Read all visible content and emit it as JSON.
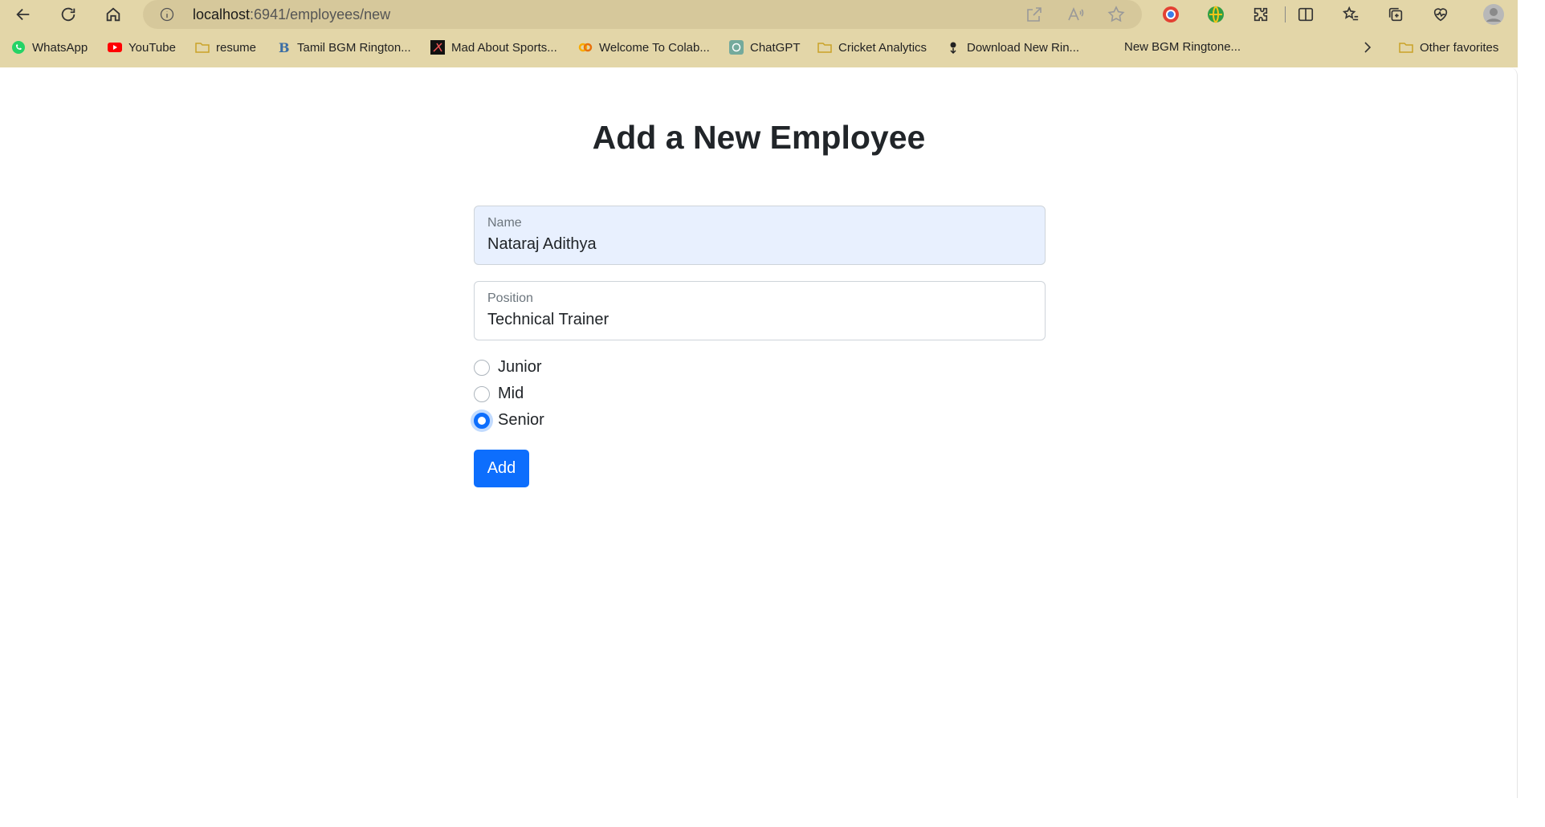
{
  "browser": {
    "url_host": "localhost",
    "url_rest": ":6941/employees/new",
    "bookmarks": [
      {
        "label": "WhatsApp",
        "icon": "whatsapp-icon"
      },
      {
        "label": "YouTube",
        "icon": "youtube-icon"
      },
      {
        "label": "resume",
        "icon": "folder-icon"
      },
      {
        "label": "Tamil BGM Rington...",
        "icon": "bgm-icon"
      },
      {
        "label": "Mad About Sports...",
        "icon": "sports-icon"
      },
      {
        "label": "Welcome To Colab...",
        "icon": "colab-icon"
      },
      {
        "label": "ChatGPT",
        "icon": "chatgpt-icon"
      },
      {
        "label": "Cricket Analytics",
        "icon": "folder-icon"
      },
      {
        "label": "Download New Rin...",
        "icon": "download-icon"
      },
      {
        "label": "New BGM Ringtone...",
        "icon": "none"
      }
    ],
    "other_favorites": "Other favorites"
  },
  "form": {
    "title": "Add a New Employee",
    "name_label": "Name",
    "name_value": "Nataraj Adithya",
    "position_label": "Position",
    "position_value": "Technical Trainer",
    "levels": [
      {
        "label": "Junior",
        "checked": false
      },
      {
        "label": "Mid",
        "checked": false
      },
      {
        "label": "Senior",
        "checked": true
      }
    ],
    "submit_label": "Add"
  },
  "colors": {
    "accent": "#0d6efd",
    "chrome": "#e3d6a8"
  }
}
